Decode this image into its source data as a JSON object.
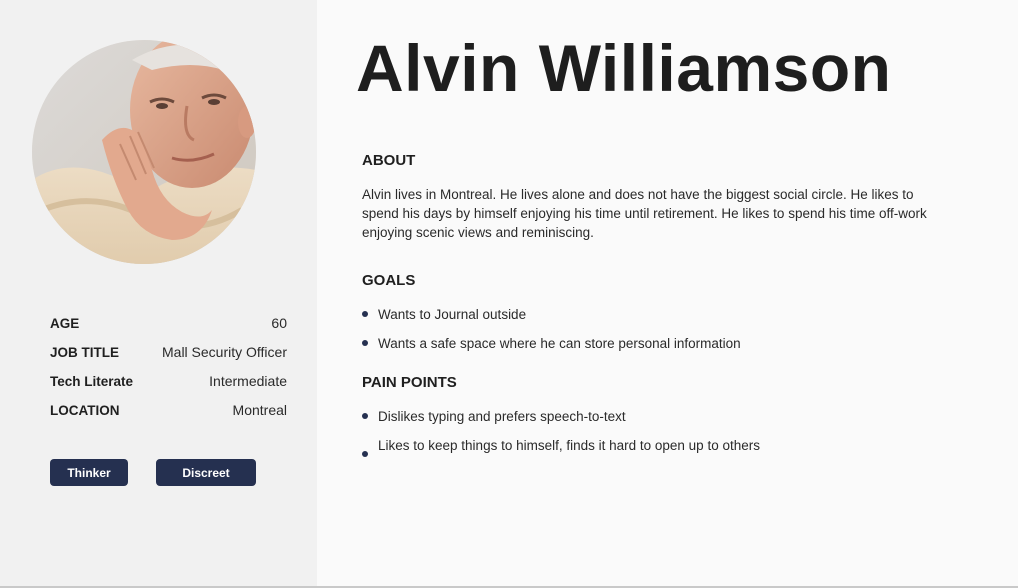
{
  "persona": {
    "name": "Alvin Williamson",
    "photo_alt": "elderly-man-portrait"
  },
  "facts": [
    {
      "label": "AGE",
      "value": "60"
    },
    {
      "label": "JOB TITLE",
      "value": "Mall Security Officer"
    },
    {
      "label": "Tech Literate",
      "value": "Intermediate"
    },
    {
      "label": "LOCATION",
      "value": "Montreal"
    }
  ],
  "tags": [
    "Thinker",
    "Discreet"
  ],
  "about": {
    "title": "ABOUT",
    "text": "Alvin lives in Montreal. He lives alone and does not have the biggest social circle. He likes to spend his days by himself enjoying his time until retirement. He likes to spend his time off-work enjoying scenic views and reminiscing."
  },
  "goals": {
    "title": "GOALS",
    "items": [
      "Wants to Journal outside",
      "Wants a safe space where he can store personal information"
    ]
  },
  "pain_points": {
    "title": "PAIN POINTS",
    "items": [
      "Dislikes typing and prefers speech-to-text",
      "Likes to keep things to himself, finds it hard to open up to others"
    ]
  },
  "colors": {
    "sidebar_bg": "#f1f1f1",
    "main_bg": "#fafafa",
    "accent": "#253050",
    "text": "#1f1f1f"
  }
}
